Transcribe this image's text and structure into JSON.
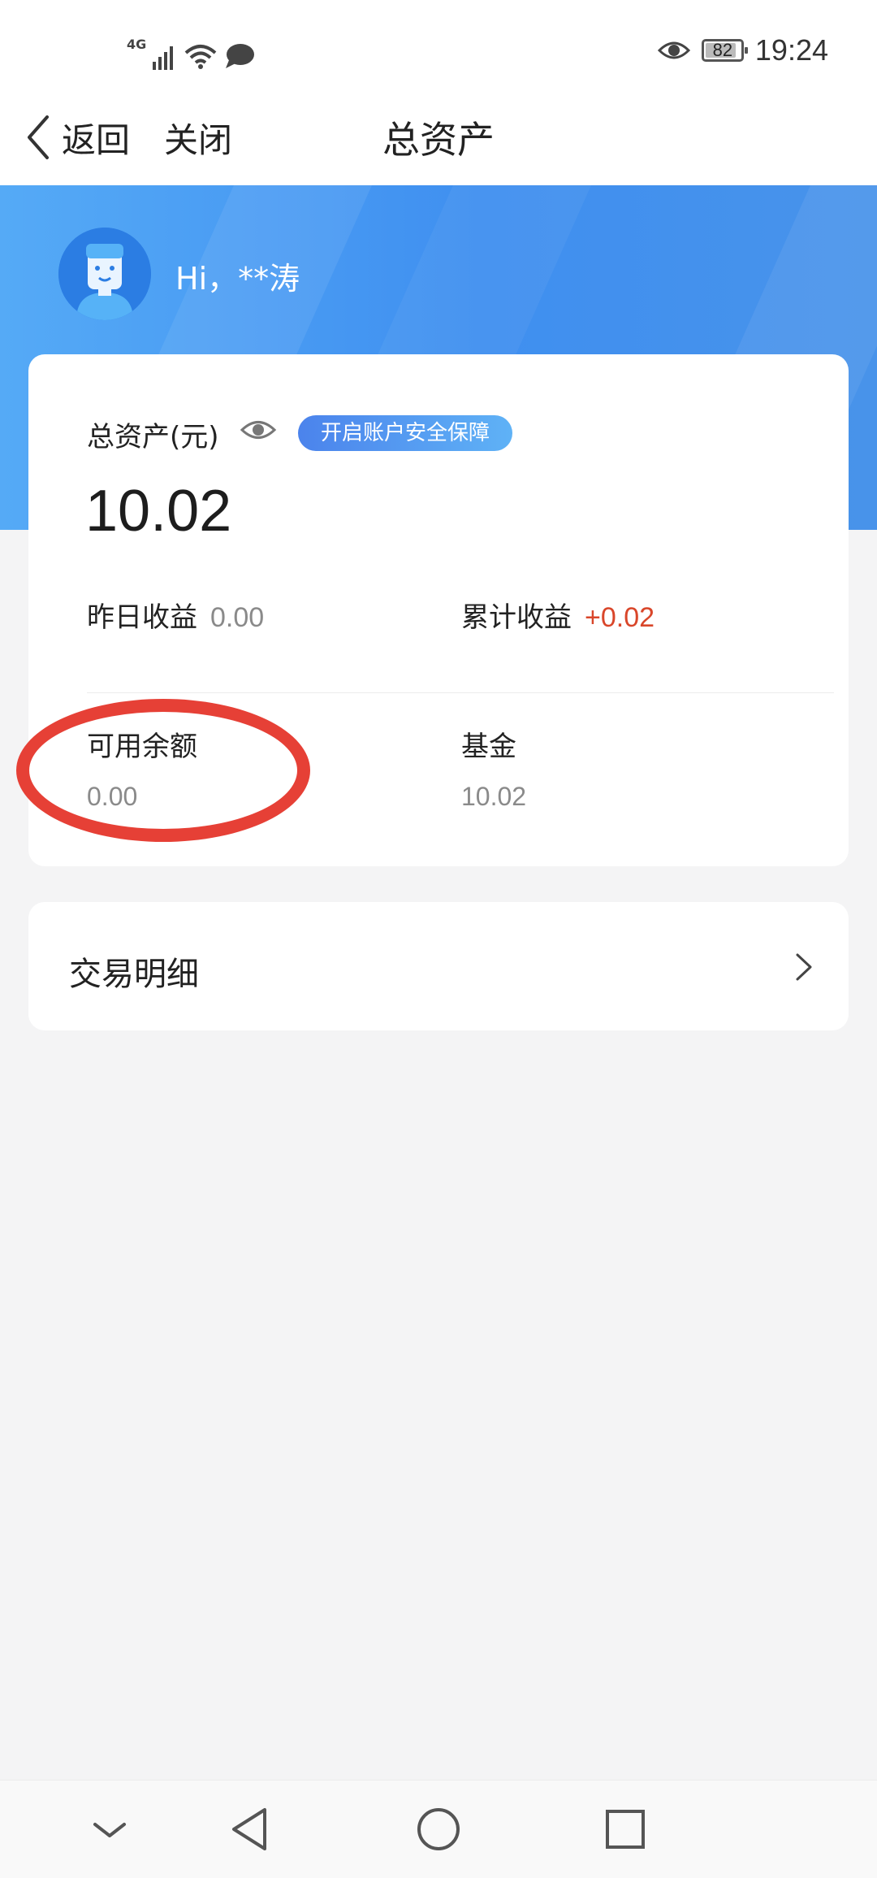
{
  "status_bar": {
    "network_label": "4G",
    "battery_level": "82",
    "time": "19:24"
  },
  "nav": {
    "back_label": "返回",
    "close_label": "关闭",
    "title": "总资产"
  },
  "header": {
    "greeting": "Hi，**涛"
  },
  "asset_card": {
    "total_label": "总资产(元)",
    "security_badge": "开启账户安全保障",
    "total_value": "10.02",
    "yesterday_label": "昨日收益",
    "yesterday_value": "0.00",
    "cumulative_label": "累计收益",
    "cumulative_value": "+0.02",
    "available_label": "可用余额",
    "available_value": "0.00",
    "fund_label": "基金",
    "fund_value": "10.02"
  },
  "transactions": {
    "label": "交易明细"
  },
  "colors": {
    "accent_blue": "#3f8ff0",
    "gain_red": "#d9462a",
    "annotation_red": "#e64036"
  },
  "icons": {
    "status": [
      "signal-icon",
      "wifi-icon",
      "message-icon",
      "eye-icon",
      "battery-icon"
    ],
    "system_nav": [
      "collapse-icon",
      "back-triangle-icon",
      "home-circle-icon",
      "recents-square-icon"
    ]
  }
}
